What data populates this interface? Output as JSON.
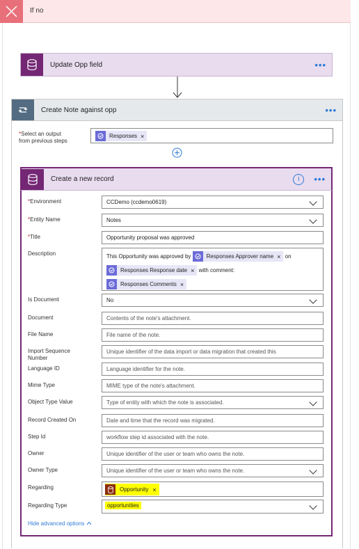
{
  "ifno": {
    "label": "If no"
  },
  "update_card": {
    "title": "Update Opp field",
    "more": "•••"
  },
  "note_card": {
    "title": "Create Note against opp",
    "more": "•••"
  },
  "select_output": {
    "label_line1": "Select an output",
    "label_line2": "from previous steps",
    "token": "Responses"
  },
  "record_card": {
    "title": "Create a new record",
    "info": "i",
    "more": "•••"
  },
  "fields": {
    "environment": {
      "label": "Environment",
      "value": "CCDemo (ccdemo0619)"
    },
    "entity_name": {
      "label": "Entity Name",
      "value": "Notes"
    },
    "title": {
      "label": "Title",
      "value": "Opportunity proposal was approved"
    },
    "description": {
      "label": "Description",
      "text1": "This Opportunity was approved by",
      "token1": "Responses Approver name",
      "text2": "on",
      "token2": "Responses Response date",
      "text3": "with comment:",
      "token3": "Responses Comments"
    },
    "is_document": {
      "label": "Is Document",
      "value": "No"
    },
    "document": {
      "label": "Document",
      "placeholder": "Contents of the note's attachment."
    },
    "file_name": {
      "label": "File Name",
      "placeholder": "File name of the note."
    },
    "import_seq": {
      "label_line1": "Import Sequence",
      "label_line2": "Number",
      "placeholder": "Unique identifier of the data import or data migration that created this"
    },
    "language_id": {
      "label": "Language ID",
      "placeholder": "Language identifier for the note."
    },
    "mime_type": {
      "label": "Mime Type",
      "placeholder": "MIME type of the note's attachment."
    },
    "object_type": {
      "label": "Object Type Value",
      "placeholder": "Type of entity with which the note is associated."
    },
    "record_created": {
      "label": "Record Created On",
      "placeholder": "Date and time that the record was migrated."
    },
    "step_id": {
      "label": "Step Id",
      "placeholder": "workflow step id associated with the note."
    },
    "owner": {
      "label": "Owner",
      "placeholder": "Unique identifier of the user or team who owns the note."
    },
    "owner_type": {
      "label": "Owner Type",
      "placeholder": "Unique identifier of the user or team who owns the note."
    },
    "regarding": {
      "label": "Regarding",
      "token": "Opportunity"
    },
    "regarding_type": {
      "label": "Regarding Type",
      "value": "opportunities"
    }
  },
  "hide_advanced": "Hide advanced options",
  "colors": {
    "accent": "#742774",
    "link": "#2f7bd6",
    "token": "#6b6bd8",
    "highlight": "#ffff00",
    "error": "#e8707a"
  }
}
